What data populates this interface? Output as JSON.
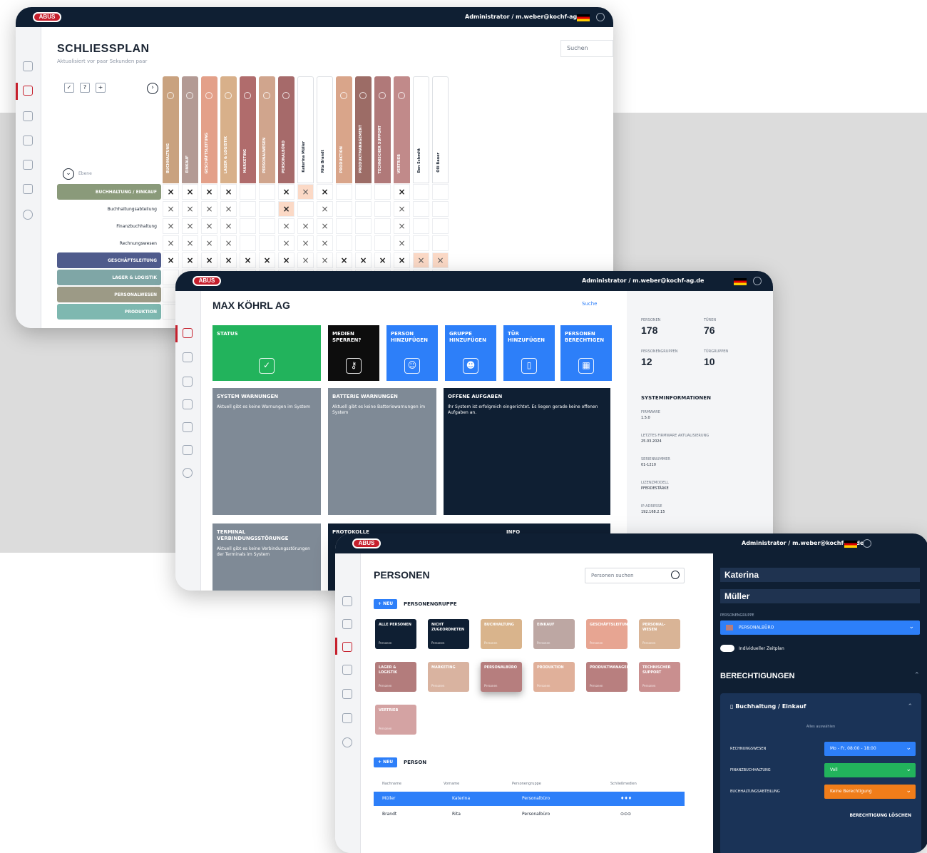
{
  "brand": {
    "logo": "ABUS"
  },
  "w1": {
    "user": "Administrator / m.weber@kochf-ag.de",
    "title": "SCHLIESSPLAN",
    "subtitle": "Aktualisiert vor paar Sekunden paar",
    "search_placeholder": "Suchen",
    "columns": [
      {
        "label": "BUCHHALTUNG",
        "color": "#c9a27f"
      },
      {
        "label": "EINKAUF",
        "color": "#b39a94"
      },
      {
        "label": "GESCHÄFTSLEITUNG",
        "color": "#e3a089"
      },
      {
        "label": "LAGER & LOGISTIK",
        "color": "#d8b08a"
      },
      {
        "label": "MARKETING",
        "color": "#b06c6c"
      },
      {
        "label": "PERSONALWESEN",
        "color": "#d0a58d"
      },
      {
        "label": "PERSONALBÜRO",
        "color": "#a66a6a"
      },
      {
        "label": "Katerina Müller",
        "color": "white"
      },
      {
        "label": "Rita Brandt",
        "color": "white"
      },
      {
        "label": "PRODUKTION",
        "color": "#d9a58a"
      },
      {
        "label": "PRODUKTMANAGEMENT",
        "color": "#9c6c66"
      },
      {
        "label": "TECHNISCHER SUPPORT",
        "color": "#b07979"
      },
      {
        "label": "VERTRIEB",
        "color": "#c18a8a"
      },
      {
        "label": "Ben Schmitt",
        "color": "white"
      },
      {
        "label": "Olli Bauer",
        "color": "white"
      }
    ],
    "rows": [
      {
        "label": "BUCHHALTUNG / EINKAUF",
        "group": true,
        "color": "#8a9a7a",
        "marks": "XXXX..XxX...X.."
      },
      {
        "label": "Buchhaltungsabteilung",
        "group": false,
        "marks": "xxxx..X.x...x.."
      },
      {
        "label": "Finanzbuchhaltung",
        "group": false,
        "marks": "xxxx..xxx...x.."
      },
      {
        "label": "Rechnungswesen",
        "group": false,
        "marks": "xxxx..xxx...x.."
      },
      {
        "label": "GESCHÄFTSLEITUNG",
        "group": true,
        "color": "#4f5b8c",
        "marks": "XXXXXXXxxXXXXxx"
      },
      {
        "label": "LAGER & LOGISTIK",
        "group": true,
        "color": "#7fa6a6",
        "marks": "..............."
      },
      {
        "label": "PERSONALWESEN",
        "group": true,
        "color": "#9c9a86",
        "marks": "..............."
      },
      {
        "label": "PRODUKTION",
        "group": true,
        "color": "#7eb8b0",
        "marks": "..............."
      }
    ],
    "collapse_label": "Ebene"
  },
  "w2": {
    "user": "Administrator / m.weber@kochf-ag.de",
    "title": "MAX KÖHRL AG",
    "search_label": "Suche",
    "tiles": [
      {
        "title": "STATUS",
        "icon": "✓",
        "color": "#22b35c"
      },
      {
        "title": "MEDIEN SPERREN?",
        "icon": "⚷",
        "color": "#0d0d0d"
      },
      {
        "title": "PERSON HINZUFÜGEN",
        "icon": "☺",
        "color": "#2d7ff9"
      },
      {
        "title": "GRUPPE HINZUFÜGEN",
        "icon": "☻",
        "color": "#2d7ff9"
      },
      {
        "title": "TÜR HINZUFÜGEN",
        "icon": "▯",
        "color": "#2d7ff9"
      },
      {
        "title": "PERSONEN BERECHTIGEN",
        "icon": "▦",
        "color": "#2d7ff9"
      }
    ],
    "warnings": [
      {
        "title": "SYSTEM WARNUNGEN",
        "text": "Aktuell gibt es keine Warnungen im System",
        "color": "#7f8a96"
      },
      {
        "title": "BATTERIE WARNUNGEN",
        "text": "Aktuell gibt es keine Batteriewarnungen im System",
        "color": "#7f8a96"
      },
      {
        "title": "OFFENE AUFGABEN",
        "text": "Ihr System ist erfolgreich eingerichtet. Es liegen gerade keine offenen Aufgaben an.",
        "color": "#0f1f33"
      }
    ],
    "bottom": [
      {
        "title": "TERMINAL VERBINDUNGSSTÖRUNGE",
        "text": "Aktuell gibt es keine Verbindungsstörungen der Terminals im System",
        "color": "#7f8a96"
      },
      {
        "title": "PROTOKOLLE",
        "text": "",
        "color": "#0f1f33"
      },
      {
        "title": "INFO",
        "text": "",
        "color": "#0f1f33"
      }
    ],
    "stats": [
      {
        "label": "PERSONEN",
        "value": "178"
      },
      {
        "label": "TÜREN",
        "value": "76"
      },
      {
        "label": "PERSONENGRUPPEN",
        "value": "12"
      },
      {
        "label": "TÜRGRUPPEN",
        "value": "10"
      }
    ],
    "sysinfo_title": "SYSTEMINFORMATIONEN",
    "sysinfo": [
      {
        "label": "FIRMWARE",
        "value": "1.5.0"
      },
      {
        "label": "LETZTES FIRMWARE AKTUALISIERUNG",
        "value": "25.03.2024"
      },
      {
        "label": "SERIENNUMMER",
        "value": "01-1210"
      },
      {
        "label": "LIZENZMODELL",
        "value": "PFERDESTÄRKE"
      },
      {
        "label": "IP-ADRESSE",
        "value": "192.168.2.15"
      }
    ]
  },
  "w3": {
    "user": "Administrator / m.weber@kochf-ag.de",
    "title": "PERSONEN",
    "search_placeholder": "Personen suchen",
    "new_label": "+ NEU",
    "group_section": "PERSONENGRUPPE",
    "person_section": "PERSON",
    "groups": [
      {
        "name": "ALLE PERSONEN",
        "sub": "Personen",
        "color": "#0f1f33"
      },
      {
        "name": "NICHT ZUGEORDNETEN",
        "sub": "Personen",
        "color": "#0f1f33"
      },
      {
        "name": "BUCHHALTUNG",
        "sub": "Personen",
        "color": "#d9b48c"
      },
      {
        "name": "EINKAUF",
        "sub": "Personen",
        "color": "#bda7a3"
      },
      {
        "name": "GESCHÄFTSLEITUNG",
        "sub": "Personen",
        "color": "#e7a592"
      },
      {
        "name": "PERSONAL-WESEN",
        "sub": "Personen",
        "color": "#d9b496"
      },
      {
        "name": "LAGER & LOGISTIK",
        "sub": "Personen",
        "color": "#b37c7c"
      },
      {
        "name": "MARKETING",
        "sub": "Personen",
        "color": "#d9b3a0"
      },
      {
        "name": "PERSONALBÜRO",
        "sub": "Personen",
        "color": "#b67e7e"
      },
      {
        "name": "PRODUKTION",
        "sub": "Personen",
        "color": "#e0b09a"
      },
      {
        "name": "PRODUKTMANAGEMENT",
        "sub": "Personen",
        "color": "#b87f7f"
      },
      {
        "name": "TECHNISCHER SUPPORT",
        "sub": "Personen",
        "color": "#c98f8f"
      },
      {
        "name": "VERTRIEB",
        "sub": "Personen",
        "color": "#d4a3a3"
      }
    ],
    "table_headers": [
      "Nachname",
      "Vorname",
      "Personengruppe",
      "Schließmedien"
    ],
    "table_rows": [
      {
        "last": "Müller",
        "first": "Katerina",
        "group": "Personalbüro",
        "media": "♦♦♦",
        "selected": true
      },
      {
        "last": "Brandt",
        "first": "Rita",
        "group": "Personalbüro",
        "media": "⊙⊙⊙",
        "selected": false
      }
    ],
    "detail": {
      "first": "Katerina",
      "last": "Müller",
      "group_label": "PERSONENGRUPPE",
      "group_value": "PERSONALBÜRO",
      "toggle_label": "Individueller Zeitplan",
      "perm_title": "BERECHTIGUNGEN",
      "perm_group": "Buchhaltung / Einkauf",
      "perm_select_all": "Alles auswählen",
      "perms": [
        {
          "door": "RECHNUNGSWESEN",
          "value": "Mo - Fr, 08:00 - 18:00",
          "color": "#2d7ff9"
        },
        {
          "door": "FINANZBUCHHALTUNG",
          "value": "Voll",
          "color": "#22b35c"
        },
        {
          "door": "BUCHHALTUNGSABTEILUNG",
          "value": "Keine Berechtigung",
          "color": "#f07d1a"
        }
      ],
      "delete_label": "BERECHTIGUNG LÖSCHEN"
    }
  }
}
